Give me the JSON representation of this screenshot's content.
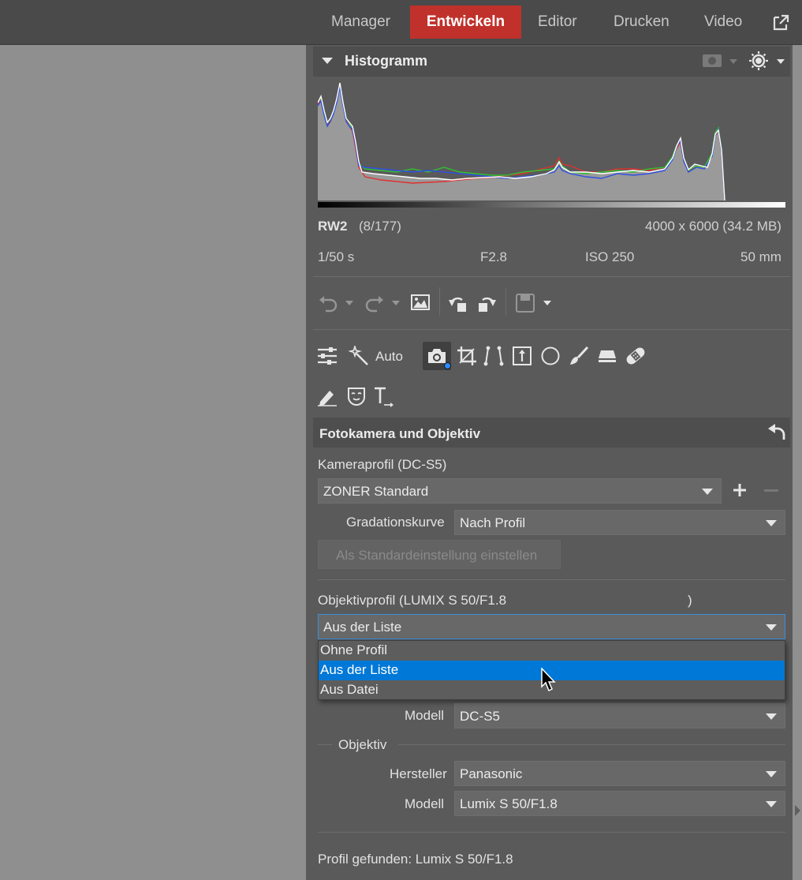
{
  "tabs": [
    {
      "label": "Manager",
      "active": false
    },
    {
      "label": "Entwickeln",
      "active": true
    },
    {
      "label": "Editor",
      "active": false
    },
    {
      "label": "Drucken",
      "active": false
    },
    {
      "label": "Video",
      "active": false
    }
  ],
  "histogram": {
    "title": "Histogramm"
  },
  "file_info": {
    "format": "RW2",
    "index": "(8/177)",
    "dimensions": "4000 x 6000 (34.2 MB)",
    "shutter": "1/50 s",
    "aperture": "F2.8",
    "iso": "ISO 250",
    "focal": "50 mm"
  },
  "toolbar": {
    "auto_label": "Auto"
  },
  "camera_section": {
    "title": "Fotokamera und Objektiv",
    "camera_profile_label": "Kameraprofil (DC-S5)",
    "camera_profile_value": "ZONER Standard",
    "gradation_label": "Gradationskurve",
    "gradation_value": "Nach Profil",
    "set_default_button": "Als Standardeinstellung einstellen",
    "lens_profile_label": "Objektivprofil (LUMIX S 50/F1.8",
    "lens_profile_close": ")",
    "lens_profile_value": "Aus der Liste",
    "options": [
      "Ohne Profil",
      "Aus der Liste",
      "Aus Datei"
    ],
    "selected_option": "Aus der Liste",
    "camera_model_label": "Modell",
    "camera_model_value": "DC-S5",
    "lens_group_label": "Objektiv",
    "manufacturer_label": "Hersteller",
    "manufacturer_value": "Panasonic",
    "lens_model_label": "Modell",
    "lens_model_value": "Lumix S 50/F1.8",
    "status_text": "Profil gefunden: Lumix S 50/F1.8"
  },
  "colors": {
    "active_tab": "#c0312b",
    "selection": "#0078d7",
    "panel_bg": "#5a5a5a"
  }
}
